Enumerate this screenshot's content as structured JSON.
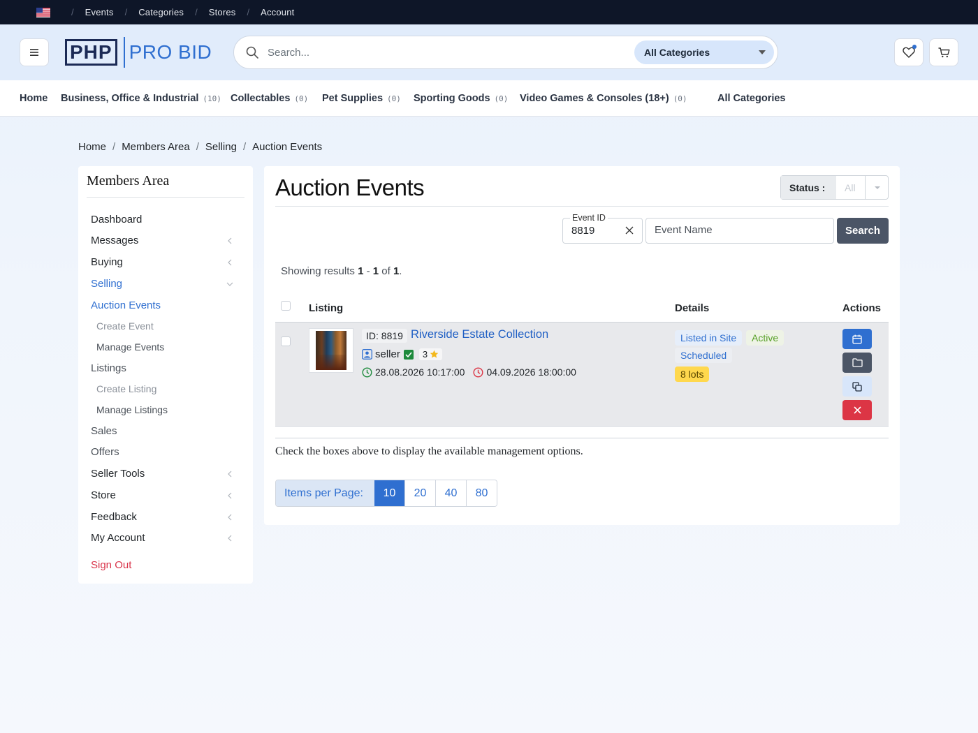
{
  "topbar": {
    "links": [
      "Events",
      "Categories",
      "Stores",
      "Account"
    ]
  },
  "header": {
    "logo_left": "PHP",
    "logo_right": "PRO BID",
    "search_placeholder": "Search...",
    "category_select": "All Categories"
  },
  "catnav": {
    "home": "Home",
    "items": [
      {
        "label": "Business, Office & Industrial",
        "count": "(10)"
      },
      {
        "label": "Collectables",
        "count": "(0)"
      },
      {
        "label": "Pet Supplies",
        "count": "(0)"
      },
      {
        "label": "Sporting Goods",
        "count": "(0)"
      },
      {
        "label": "Video Games & Consoles (18+)",
        "count": "(0)"
      }
    ],
    "all": "All Categories"
  },
  "breadcrumb": [
    "Home",
    "Members Area",
    "Selling",
    "Auction Events"
  ],
  "sidebar": {
    "title": "Members Area",
    "items": {
      "dashboard": "Dashboard",
      "messages": "Messages",
      "buying": "Buying",
      "selling": "Selling",
      "auction_events": "Auction Events",
      "create_event": "Create Event",
      "manage_events": "Manage Events",
      "listings": "Listings",
      "create_listing": "Create Listing",
      "manage_listings": "Manage Listings",
      "sales": "Sales",
      "offers": "Offers",
      "seller_tools": "Seller Tools",
      "store": "Store",
      "feedback": "Feedback",
      "my_account": "My Account",
      "sign_out": "Sign Out"
    }
  },
  "main": {
    "title": "Auction Events",
    "status_label": "Status :",
    "status_value": "All",
    "filter": {
      "event_id_label": "Event ID",
      "event_id_value": "8819",
      "event_name_placeholder": "Event Name",
      "search_button": "Search"
    },
    "results": {
      "prefix": "Showing results",
      "from": "1",
      "dash": "-",
      "to": "1",
      "of": "of",
      "total": "1",
      "end": "."
    },
    "columns": {
      "listing": "Listing",
      "details": "Details",
      "actions": "Actions"
    },
    "row": {
      "id": "ID: 8819",
      "name": "Riverside Estate Collection",
      "seller": "seller",
      "feedback": "3",
      "start": "28.08.2026 10:17:00",
      "end": "04.09.2026 18:00:00",
      "tags": {
        "site": "Listed in Site",
        "active": "Active",
        "scheduled": "Scheduled",
        "lots": "8 lots"
      }
    },
    "hint": "Check the boxes above to display the available management options.",
    "pager": {
      "label": "Items per Page:",
      "options": [
        "10",
        "20",
        "40",
        "80"
      ],
      "current": "10"
    }
  },
  "colors": {
    "accent": "#2f6fd0",
    "danger": "#dc3545",
    "dark": "#0e1628",
    "warning": "#ffd84d"
  }
}
